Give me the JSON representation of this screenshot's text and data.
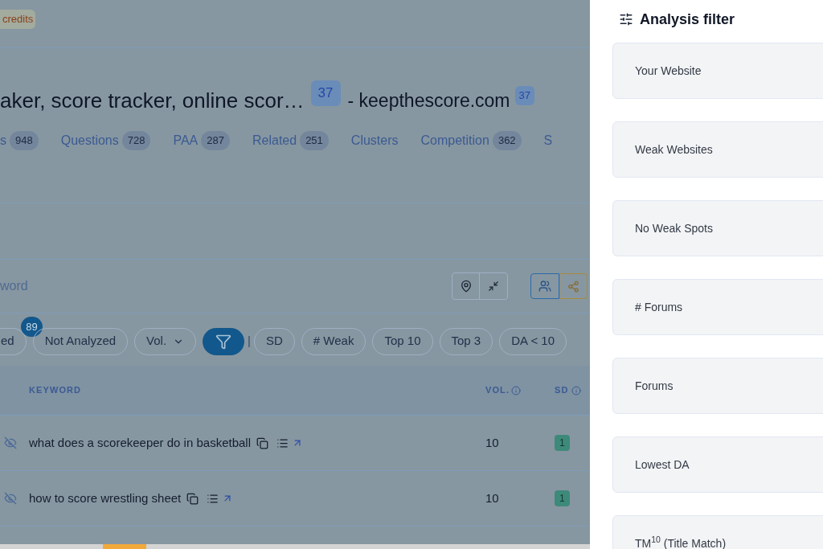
{
  "top_bar": {
    "credits": "credits"
  },
  "header": {
    "title": "aker, score tracker, online scor…",
    "title_badge": "37",
    "domain": "- keepthescore.com",
    "domain_badge": "37"
  },
  "tabs": [
    {
      "label": "s",
      "count": "948"
    },
    {
      "label": "Questions",
      "count": "728"
    },
    {
      "label": "PAA",
      "count": "287"
    },
    {
      "label": "Related",
      "count": "251"
    },
    {
      "label": "Clusters"
    },
    {
      "label": "Competition",
      "count": "362"
    },
    {
      "label": "S"
    }
  ],
  "search": {
    "placeholder": "word"
  },
  "chips": [
    {
      "kind": "text",
      "label": "ed",
      "badge": "89",
      "selected": false
    },
    {
      "kind": "text",
      "label": "Not Analyzed",
      "selected": false
    },
    {
      "kind": "dropdown",
      "label": "Vol.",
      "selected": false
    },
    {
      "kind": "icon",
      "selected": true
    },
    {
      "kind": "divider",
      "label": "|"
    },
    {
      "kind": "text",
      "label": "SD",
      "selected": false
    },
    {
      "kind": "text",
      "label": "# Weak",
      "selected": false
    },
    {
      "kind": "text",
      "label": "Top 10",
      "selected": false
    },
    {
      "kind": "text",
      "label": "Top 3",
      "selected": false
    },
    {
      "kind": "text",
      "label": "DA  < 10",
      "selected": false
    }
  ],
  "table": {
    "columns": [
      "KEYWORD",
      "VOL.",
      "SD"
    ],
    "rows": [
      {
        "keyword": "what does a scorekeeper do in basketball",
        "vol": "10",
        "sd": "1"
      },
      {
        "keyword": "how to score wrestling sheet",
        "vol": "10",
        "sd": "1"
      }
    ]
  },
  "drawer": {
    "title": "Analysis filter",
    "items": [
      "Your Website",
      "Weak Websites",
      "No Weak Spots",
      "# Forums",
      "Forums",
      "Lowest DA",
      "TM$^{10}$ (Title Match)"
    ]
  }
}
